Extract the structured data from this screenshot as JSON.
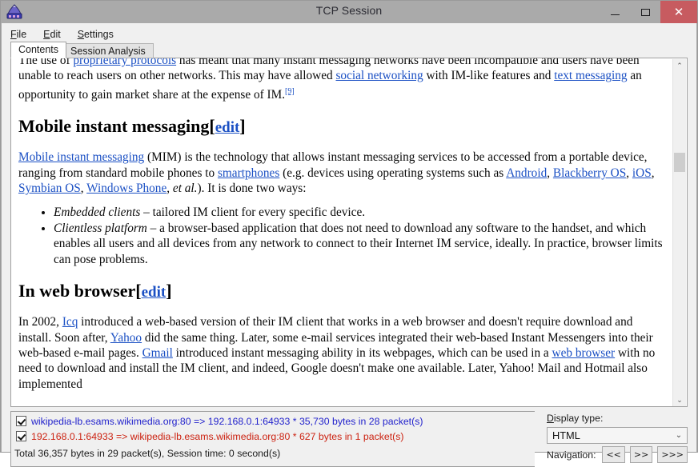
{
  "window": {
    "title": "TCP Session",
    "icon": "shark-fin-icon",
    "minimize": "–",
    "maximize": "□",
    "close": "✕"
  },
  "menubar": [
    {
      "label": "File",
      "accel": "F"
    },
    {
      "label": "Edit",
      "accel": "E"
    },
    {
      "label": "Settings",
      "accel": "S"
    }
  ],
  "tabs": [
    {
      "label": "Contents",
      "active": true
    },
    {
      "label": "Session Analysis",
      "active": false
    }
  ],
  "document": {
    "para_top_prefix": "The use of ",
    "link_proprietary": "proprietary protocols",
    "para_top_rest": " has meant that many instant messaging networks have been incompatible and users have been unable to reach users on other networks. This may have allowed ",
    "link_social": "social networking",
    "para_top_mid": " with IM-like features and ",
    "link_textmsg": "text messaging",
    "para_top_end": " an opportunity to gain market share at the expense of IM.",
    "ref9": "[9]",
    "h2_mobile": "Mobile instant messaging",
    "edit_label": "edit",
    "bracket_open": "[",
    "bracket_close": "]",
    "mim_link": "Mobile instant messaging",
    "mim_t1": " (MIM) is the technology that allows instant messaging services to be accessed from a portable device, ranging from standard mobile phones to ",
    "link_smartphones": "smartphones",
    "mim_t2": " (e.g. devices using operating systems such as ",
    "link_android": "Android",
    "sep_comma": ", ",
    "link_blackberry": "Blackberry OS",
    "link_ios": "iOS",
    "link_symbian": "Symbian OS",
    "link_winphone": "Windows Phone",
    "mim_t3": ", ",
    "etal": "et al.",
    "mim_t4": "). It is done two ways:",
    "bullet1_em": "Embedded clients",
    "bullet1_text": " – tailored IM client for every specific device.",
    "bullet2_em": "Clientless platform",
    "bullet2_text": " – a browser-based application that does not need to download any software to the handset, and which enables all users and all devices from any network to connect to their Internet IM service, ideally. In practice, browser limits can pose problems.",
    "h2_webbrowser": "In web browser",
    "web_t1": "In 2002, ",
    "link_icq": "Icq",
    "web_t2": " introduced a web-based version of their IM client that works in a web browser and doesn't require download and install. Soon after, ",
    "link_yahoo": "Yahoo",
    "web_t3": " did the same thing. Later, some e-mail services integrated their web-based Instant Messengers into their web-based e-mail pages. ",
    "link_gmail": "Gmail",
    "web_t4": " introduced instant messaging ability in its webpages, which can be used in a ",
    "link_webbrowser": "web browser",
    "web_t5": " with no need to download and install the IM client, and indeed, Google doesn't make one available. Later, Yahoo! Mail and Hotmail also implemented"
  },
  "scrollbar": {
    "up_arrow": "⌃",
    "down_arrow": "⌄"
  },
  "packets": [
    {
      "checked": true,
      "direction": "in",
      "text": "wikipedia-lb.esams.wikimedia.org:80 => 192.168.0.1:64933 * 35,730 bytes in 28 packet(s)",
      "color": "#2222cc"
    },
    {
      "checked": true,
      "direction": "out",
      "text": "192.168.0.1:64933 => wikipedia-lb.esams.wikimedia.org:80 * 627 bytes in 1 packet(s)",
      "color": "#cc2211"
    }
  ],
  "status": {
    "total": "Total 36,357 bytes in 29 packet(s), Session time: 0 second(s)"
  },
  "controls": {
    "display_type_label": "Display type:",
    "display_type_accel": "D",
    "display_type_value": "HTML",
    "combo_arrow": "⌄",
    "navigation_label": "Navigation:",
    "nav_buttons": [
      {
        "label": "<<",
        "name": "nav-prev-button"
      },
      {
        "label": ">>",
        "name": "nav-next-button"
      },
      {
        "label": ">>>",
        "name": "nav-last-button"
      }
    ]
  }
}
